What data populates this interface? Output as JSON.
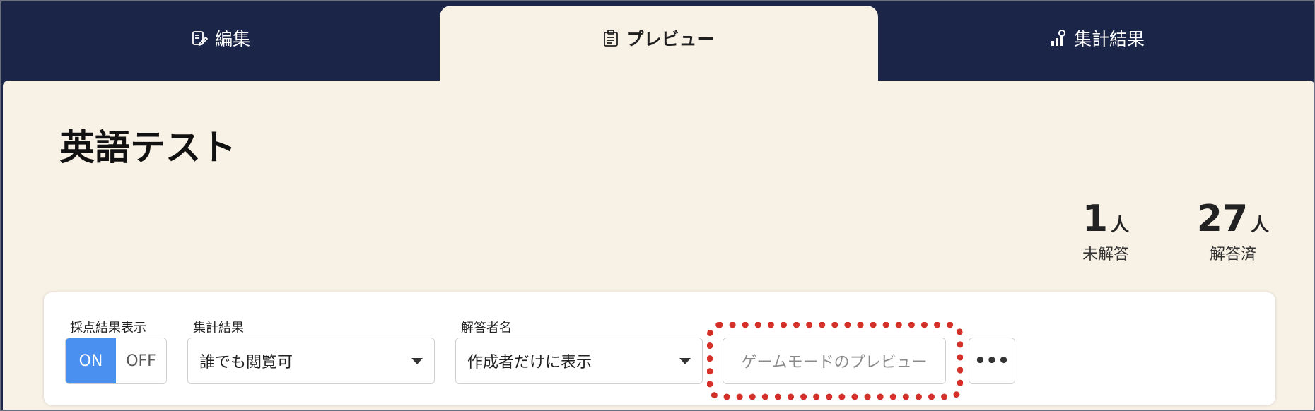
{
  "tabs": {
    "edit": "編集",
    "preview": "プレビュー",
    "results": "集計結果"
  },
  "title": "英語テスト",
  "stats": {
    "unanswered": {
      "value": "1",
      "unit": "人",
      "caption": "未解答"
    },
    "answered": {
      "value": "27",
      "unit": "人",
      "caption": "解答済"
    }
  },
  "controls": {
    "score_display_label": "採点結果表示",
    "toggle_on": "ON",
    "toggle_off": "OFF",
    "toggle_state": "ON",
    "results_label": "集計結果",
    "results_value": "誰でも閲覧可",
    "respondent_label": "解答者名",
    "respondent_value": "作成者だけに表示",
    "game_preview": "ゲームモードのプレビュー",
    "more": "•••"
  },
  "colors": {
    "header_bg": "#1a2548",
    "panel_bg": "#f8f1e6",
    "toggle_on": "#4a90f0",
    "highlight": "#d4302a"
  },
  "icons": [
    "edit-icon",
    "clipboard-icon",
    "chart-icon",
    "chevron-down-icon",
    "more-icon"
  ]
}
